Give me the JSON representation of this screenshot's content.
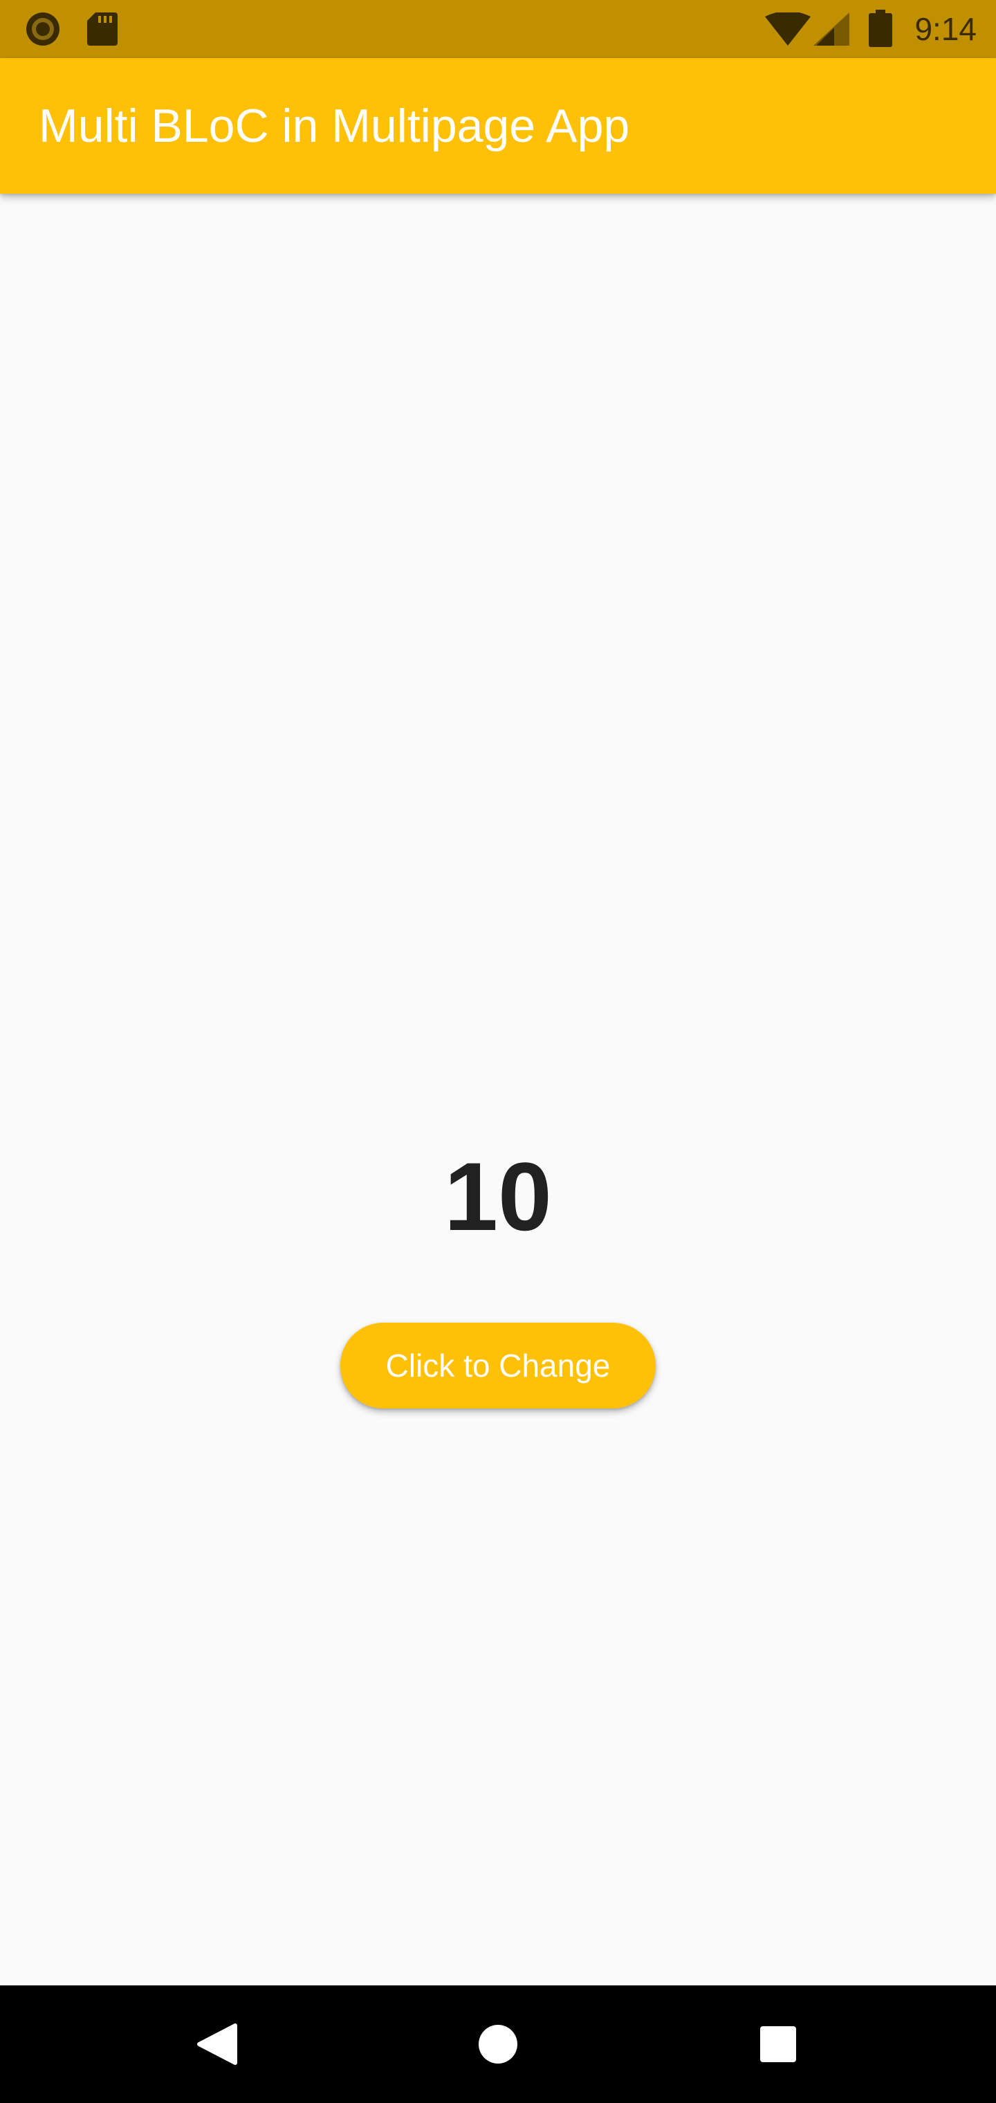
{
  "status_bar": {
    "time": "9:14",
    "icons": [
      "record-icon",
      "sd-card-icon",
      "wifi-icon",
      "cellular-signal-icon",
      "battery-icon"
    ],
    "background_color": "#c09000"
  },
  "app_bar": {
    "title": "Multi BLoC in Multipage App",
    "background_color": "#ffc107"
  },
  "main": {
    "counter_value": "10",
    "change_button_label": "Click to Change",
    "button_color": "#ffc107"
  },
  "nav_bar": {
    "buttons": [
      "back-icon",
      "home-icon",
      "recents-icon"
    ]
  }
}
